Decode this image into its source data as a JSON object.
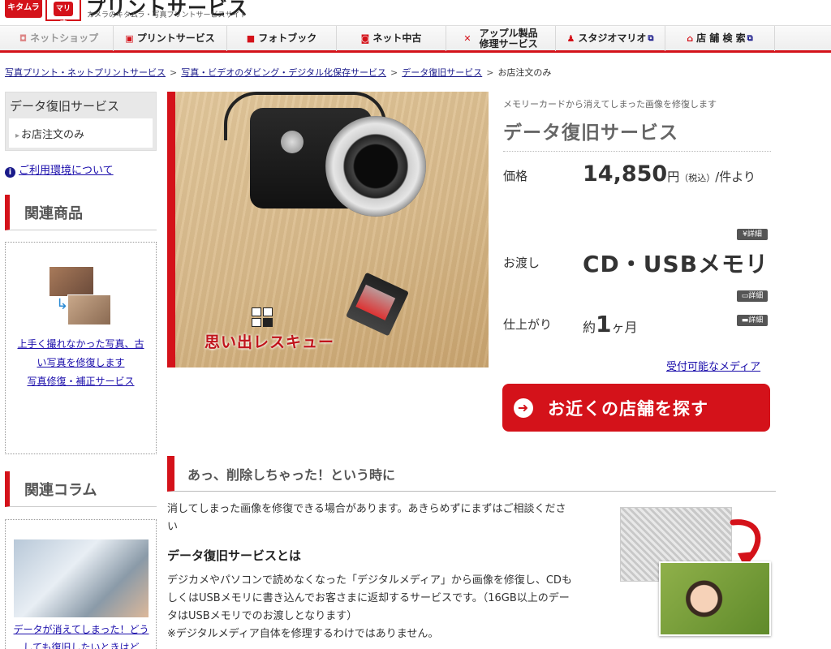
{
  "header": {
    "logo_kitamura": "キタムラ",
    "logo_mario": "マリオ",
    "title": "プリントサービス",
    "subtitle": "カメラのキタムラ・写真プリントサービスサイト"
  },
  "nav": {
    "items": [
      {
        "label": "ネットショップ",
        "icon": "camera-icon"
      },
      {
        "label": "プリントサービス",
        "icon": "print-icon"
      },
      {
        "label": "フォトブック",
        "icon": "book-icon"
      },
      {
        "label": "ネット中古",
        "icon": "used-camera-icon"
      },
      {
        "label_line1": "アップル製品",
        "label_line2": "修理サービス",
        "icon": "wrench-icon"
      },
      {
        "label": "スタジオマリオ",
        "icon": "person-icon"
      },
      {
        "label": "店 舗 検 索",
        "icon": "home-icon"
      }
    ]
  },
  "breadcrumb": {
    "items": [
      "写真プリント・ネットプリントサービス",
      "写真・ビデオのダビング・デジタル化保存サービス",
      "データ復旧サービス"
    ],
    "current": "お店注文のみ"
  },
  "sidebar": {
    "box_title": "データ復旧サービス",
    "box_item": "お店注文のみ",
    "env_link": "ご利用環境について",
    "related_products_heading": "関連商品",
    "related_products_link1": "上手く撮れなかった写真、古い写真を修復します",
    "related_products_link2": "写真修復・補正サービス",
    "related_column_heading": "関連コラム",
    "related_column_link": "データが消えてしまった！どうしても復旧したいときはど"
  },
  "hero": {
    "rescue_text": "思い出レスキュー"
  },
  "product": {
    "catch": "メモリーカードから消えてしまった画像を修復します",
    "title": "データ復旧サービス",
    "price_label": "価格",
    "price_value": "14,850",
    "price_unit": "円",
    "price_tax": "（税込）",
    "price_suffix": "/件より",
    "price_detail": "¥詳細",
    "delivery_label": "お渡し",
    "delivery_value": "CD・USBメモリ",
    "delivery_detail": "詳細",
    "finish_label": "仕上がり",
    "finish_prefix": "約",
    "finish_num": "1",
    "finish_unit": "ヶ月",
    "finish_detail": "詳細",
    "media_link": "受付可能なメディア",
    "store_button": "お近くの店舗を探す"
  },
  "content": {
    "heading": "あっ、削除しちゃった！という時に",
    "intro": "消してしまった画像を修復できる場合があります。あきらめずにまずはご相談ください",
    "subheading": "データ復旧サービスとは",
    "body1": "デジカメやパソコンで読めなくなった「デジタルメディア」から画像を修復し、CDもしくはUSBメモリに書き込んでお客さまに返却するサービスです。（16GB以上のデータはUSBメモリでのお渡しとなります）",
    "body2": "※デジタルメディア自体を修理するわけではありません。"
  },
  "colors": {
    "accent": "#d4121a",
    "link": "#1a1a8a"
  }
}
